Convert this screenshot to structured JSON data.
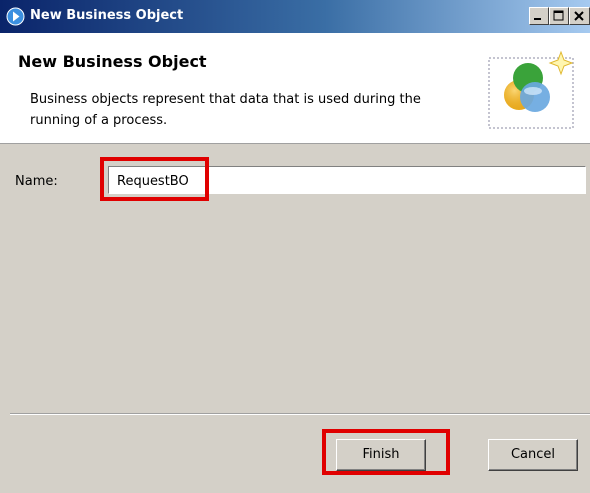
{
  "window": {
    "title": "New Business Object",
    "icon": "wizard-arrow-icon"
  },
  "header": {
    "title": "New Business Object",
    "description": "Business objects represent that data that is used during the running of a process.",
    "icon": "business-object-wizard-icon"
  },
  "form": {
    "name_label": "Name:",
    "name_value": "RequestBO"
  },
  "buttons": {
    "finish": "Finish",
    "cancel": "Cancel"
  },
  "colors": {
    "highlight": "#e00000",
    "dialog_bg": "#d4d0c8",
    "titlebar": "#0a246a"
  }
}
